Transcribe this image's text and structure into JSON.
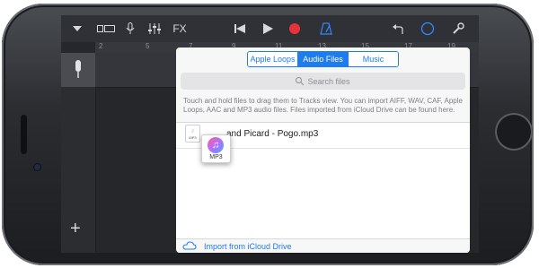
{
  "toolbar": {
    "fx_label": "FX",
    "icons": [
      "chevron-down-icon",
      "tracks-view-icon",
      "microphone-icon",
      "mixer-icon",
      "fx-icon",
      "rewind-icon",
      "play-icon",
      "record-icon",
      "metronome-icon",
      "undo-icon",
      "loop-browser-icon",
      "settings-wrench-icon"
    ]
  },
  "ruler": {
    "marks": [
      "2",
      "5",
      "7",
      "9",
      "11",
      "13",
      "15",
      "17",
      "19"
    ]
  },
  "browser": {
    "tabs": [
      {
        "label": "Apple Loops",
        "active": false
      },
      {
        "label": "Audio Files",
        "active": true
      },
      {
        "label": "Music",
        "active": false
      }
    ],
    "search_placeholder": "Search files",
    "description": "Touch and hold files to drag them to Tracks view. You can import AIFF, WAV, CAF, Apple Loops, AAC and MP3 audio files. Files imported from iCloud Drive can be found here.",
    "files": [
      {
        "title": "and Picard - Pogo.mp3",
        "icon_label": "MP3"
      }
    ],
    "drag_label": "MP3",
    "import_label": "Import from iCloud Drive"
  },
  "colors": {
    "accent": "#1e7cf0",
    "record": "#e8323a"
  }
}
